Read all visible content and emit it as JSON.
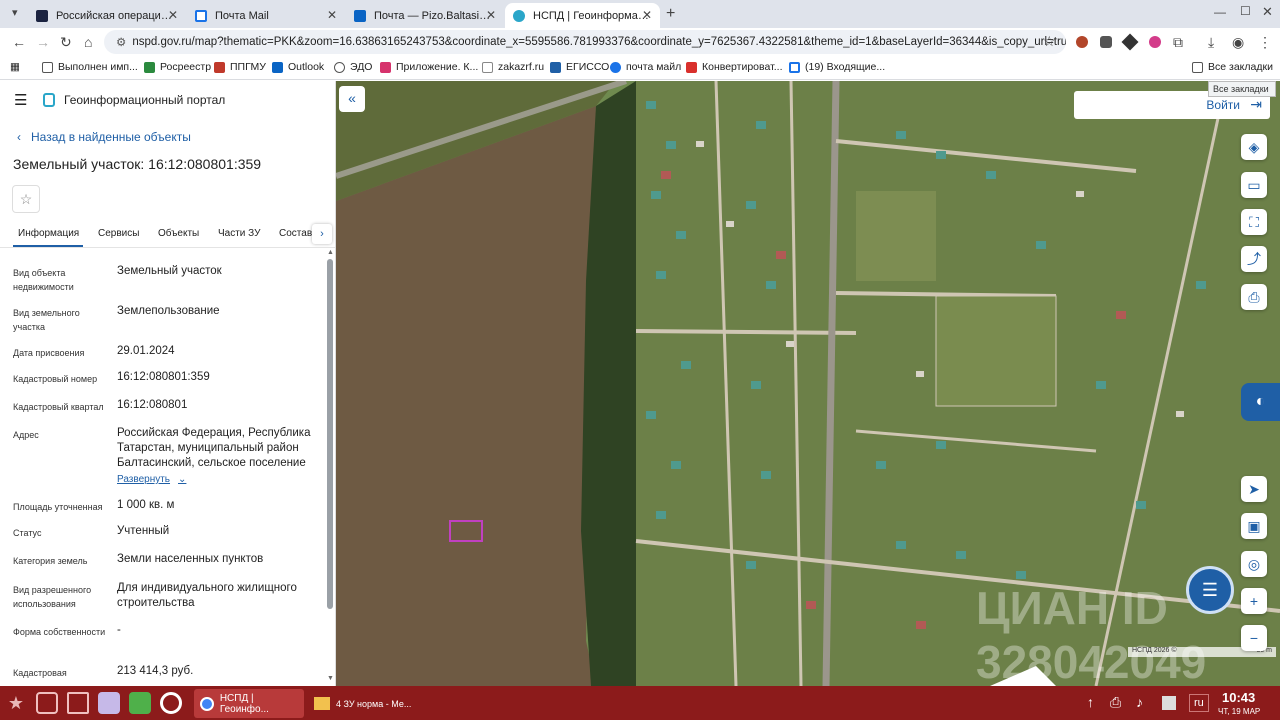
{
  "browser": {
    "tabs": [
      {
        "title": "Российская операционн...",
        "active": false
      },
      {
        "title": "Почта Mail",
        "active": false
      },
      {
        "title": "Почта — Pizo.Baltasi@tat...",
        "active": false
      },
      {
        "title": "НСПД | Геоинформацион...",
        "active": true
      }
    ],
    "new_tab": "+",
    "url": "nspd.gov.ru/map?thematic=PKK&zoom=16.63863165243753&coordinate_x=5595586.781993376&coordinate_y=7625367.4322581&theme_id=1&baseLayerId=36344&is_copy_url=true&selec...",
    "bookmarks": [
      "Выполнен имп...",
      "Росреестр",
      "ППГМУ",
      "Outlook",
      "ЭДО",
      "Приложение. К...",
      "zakazrf.ru",
      "ЕГИССО",
      "почта майл",
      "Конвертироват...",
      "(19) Входящие..."
    ],
    "all_bookmarks": "Все закладки",
    "all_bookmarks_tooltip": "Все закладки"
  },
  "portal": {
    "title": "Геоинформационный портал",
    "back_link": "Назад в найденные объекты",
    "object_title": "Земельный участок: 16:12:080801:359",
    "tabs": [
      "Информация",
      "Сервисы",
      "Объекты",
      "Части ЗУ",
      "Состав"
    ],
    "details": [
      {
        "label": "Вид объекта недвижимости",
        "value": "Земельный участок"
      },
      {
        "label": "Вид земельного участка",
        "value": "Землепользование"
      },
      {
        "label": "Дата присвоения",
        "value": "29.01.2024"
      },
      {
        "label": "Кадастровый номер",
        "value": "16:12:080801:359"
      },
      {
        "label": "Кадастровый квартал",
        "value": "16:12:080801"
      },
      {
        "label": "Адрес",
        "value": "Российская Федерация, Республика Татарстан, муниципальный район Балтасинский, сельское поселение"
      },
      {
        "label": "Площадь уточненная",
        "value": "1 000 кв. м"
      },
      {
        "label": "Статус",
        "value": "Учтенный"
      },
      {
        "label": "Категория земель",
        "value": "Земли населенных пунктов"
      },
      {
        "label": "Вид разрешенного использования",
        "value": "Для индивидуального жилищного строительства"
      },
      {
        "label": "Форма собственности",
        "value": "-"
      },
      {
        "label": "Кадастровая",
        "value": "213 414,3 руб."
      }
    ],
    "expand_link": "Развернуть"
  },
  "map": {
    "login": "Войти",
    "attribution": "НСПД 2026 ©",
    "scale": "50 m",
    "watermark": "ЦИАН ID 328042049"
  },
  "taskbar": {
    "window1": "НСПД | Геоинфо...",
    "window2": "4 ЗУ норма - Ме...",
    "lang": "ru",
    "time": "10:43",
    "date": "ЧТ, 19 МАР"
  },
  "colors": {
    "accent": "#1f5fa6",
    "taskbar": "#8c1b1b",
    "parcel": "#c040c0"
  }
}
